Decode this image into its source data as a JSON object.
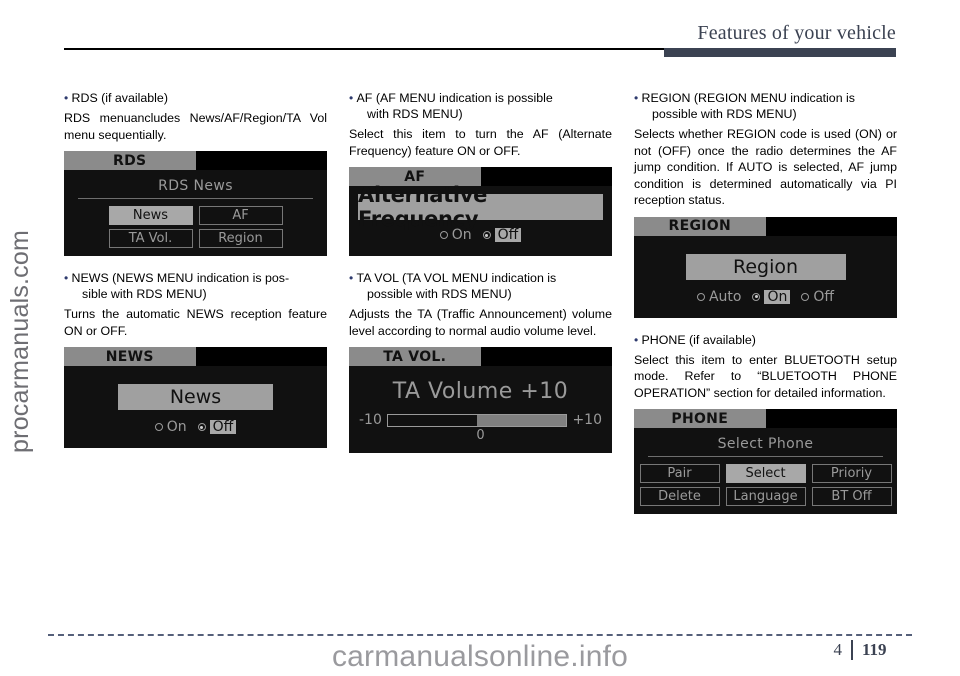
{
  "header": {
    "title": "Features of your vehicle"
  },
  "footer": {
    "chapter": "4",
    "page": "119"
  },
  "watermarks": {
    "left": "procarmanuals.com",
    "bottom": "carmanualsonline.info"
  },
  "columns": [
    {
      "blocks": [
        {
          "type": "bullet",
          "text": "RDS (if available)"
        },
        {
          "type": "para",
          "text": "RDS menuancludes News/AF/Region/TA Vol menu sequentially."
        },
        {
          "type": "screen",
          "name": "rds",
          "tab": "RDS",
          "heading": "RDS News",
          "divider": true,
          "buttons": [
            {
              "label": "News",
              "selected": true
            },
            {
              "label": "AF",
              "selected": false
            },
            {
              "label": "TA Vol.",
              "selected": false
            },
            {
              "label": "Region",
              "selected": false
            }
          ]
        },
        {
          "type": "bullet",
          "text": "NEWS (NEWS MENU indication is pos-",
          "cont": "sible with RDS MENU)"
        },
        {
          "type": "para",
          "text": "Turns the automatic NEWS reception feature ON or OFF."
        },
        {
          "type": "screen",
          "name": "news",
          "tab": "NEWS",
          "wide_button": "News",
          "radios": [
            {
              "label": "On",
              "selected": false
            },
            {
              "label": "Off",
              "selected": true
            }
          ]
        }
      ]
    },
    {
      "blocks": [
        {
          "type": "bullet",
          "text": "AF (AF MENU indication is possible",
          "cont": "with RDS MENU)"
        },
        {
          "type": "para",
          "text": "Select this item to turn the AF (Alternate Frequency) feature ON or OFF."
        },
        {
          "type": "screen",
          "name": "af",
          "tab": "AF",
          "wide_button": "Alternative Frequency",
          "radios": [
            {
              "label": "On",
              "selected": false
            },
            {
              "label": "Off",
              "selected": true
            }
          ]
        },
        {
          "type": "bullet",
          "text": "TA VOL (TA VOL MENU indication is",
          "cont": "possible with RDS MENU)"
        },
        {
          "type": "para",
          "text": "Adjusts the TA (Traffic Announcement) volume level according to normal audio volume level."
        },
        {
          "type": "screen",
          "name": "ta-vol",
          "tab": "TA VOL.",
          "slider": {
            "title": "TA Volume +10",
            "min_label": "-10",
            "max_label": "+10",
            "center_label": "0",
            "fill_percent": 50
          }
        }
      ]
    },
    {
      "blocks": [
        {
          "type": "bullet",
          "text": "REGION (REGION MENU indication is",
          "cont": "possible with RDS MENU)"
        },
        {
          "type": "para",
          "text": "Selects whether REGION code is used (ON) or not (OFF) once the radio determines the AF jump condition. If AUTO is selected, AF jump condition is determined automatically via PI reception status."
        },
        {
          "type": "screen",
          "name": "region",
          "tab": "REGION",
          "wide_button": "Region",
          "radios": [
            {
              "label": "Auto",
              "selected": false
            },
            {
              "label": "On",
              "selected": true
            },
            {
              "label": "Off",
              "selected": false
            }
          ]
        },
        {
          "type": "bullet",
          "text": "PHONE (if available)"
        },
        {
          "type": "para",
          "text": "Select this item to enter BLUETOOTH setup mode. Refer to “BLUETOOTH PHONE OPERATION” section for detailed information."
        },
        {
          "type": "screen",
          "name": "phone",
          "tab": "PHONE",
          "heading": "Select Phone",
          "divider": true,
          "buttons": [
            {
              "label": "Pair",
              "selected": false
            },
            {
              "label": "Select",
              "selected": true
            },
            {
              "label": "Prioriy",
              "selected": false
            },
            {
              "label": "Delete",
              "selected": false
            },
            {
              "label": "Language",
              "selected": false
            },
            {
              "label": "BT Off",
              "selected": false
            }
          ]
        }
      ]
    }
  ]
}
